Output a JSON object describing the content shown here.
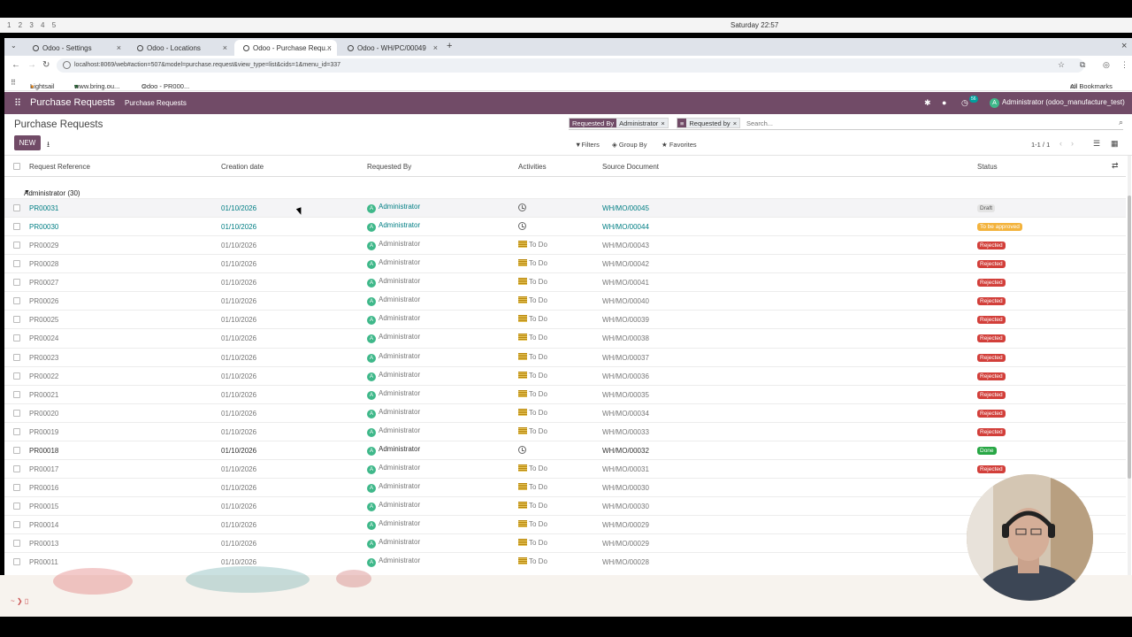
{
  "os": {
    "workspaces": "1 2 3 4 5",
    "clock": "Saturday 22:57"
  },
  "browser": {
    "tabs": [
      {
        "label": "Odoo - Settings",
        "active": false
      },
      {
        "label": "Odoo - Locations",
        "active": false
      },
      {
        "label": "Odoo - Purchase Requ...",
        "active": true
      },
      {
        "label": "Odoo - WH/PC/00049",
        "active": false
      }
    ],
    "url": "localhost:8069/web#action=507&model=purchase.request&view_type=list&cids=1&menu_id=337",
    "bookmarks": [
      "Lightsail",
      "www.bring.ou...",
      "Odoo - PR000..."
    ],
    "all_bookmarks": "All Bookmarks"
  },
  "odoo": {
    "app_name": "Purchase Requests",
    "menu": [
      "Purchase Requests"
    ],
    "activity_count": "56",
    "user": "Administrator (odoo_manufacture_test)",
    "user_initial": "A",
    "page_title": "Purchase Requests",
    "new_label": "NEW",
    "facets": [
      {
        "key": "Requested By",
        "value": "Administrator"
      },
      {
        "key": "",
        "value": "Requested by"
      }
    ],
    "search_placeholder": "Search...",
    "filters_label": "Filters",
    "groupby_label": "Group By",
    "favorites_label": "Favorites",
    "pager": "1-1 / 1",
    "columns": [
      "Request Reference",
      "Creation date",
      "Requested By",
      "Activities",
      "Source Document",
      "Status"
    ],
    "group_label": "Administrator (30)",
    "rows": [
      {
        "ref": "PR00031",
        "date": "01/10/2026",
        "by": "Administrator",
        "activity": "",
        "src": "WH/MO/00045",
        "status": "Draft",
        "style": "link"
      },
      {
        "ref": "PR00030",
        "date": "01/10/2026",
        "by": "Administrator",
        "activity": "",
        "src": "WH/MO/00044",
        "status": "To be approved",
        "style": "link"
      },
      {
        "ref": "PR00029",
        "date": "01/10/2026",
        "by": "Administrator",
        "activity": "To Do",
        "src": "WH/MO/00043",
        "status": "Rejected",
        "style": "muted"
      },
      {
        "ref": "PR00028",
        "date": "01/10/2026",
        "by": "Administrator",
        "activity": "To Do",
        "src": "WH/MO/00042",
        "status": "Rejected",
        "style": "muted"
      },
      {
        "ref": "PR00027",
        "date": "01/10/2026",
        "by": "Administrator",
        "activity": "To Do",
        "src": "WH/MO/00041",
        "status": "Rejected",
        "style": "muted"
      },
      {
        "ref": "PR00026",
        "date": "01/10/2026",
        "by": "Administrator",
        "activity": "To Do",
        "src": "WH/MO/00040",
        "status": "Rejected",
        "style": "muted"
      },
      {
        "ref": "PR00025",
        "date": "01/10/2026",
        "by": "Administrator",
        "activity": "To Do",
        "src": "WH/MO/00039",
        "status": "Rejected",
        "style": "muted"
      },
      {
        "ref": "PR00024",
        "date": "01/10/2026",
        "by": "Administrator",
        "activity": "To Do",
        "src": "WH/MO/00038",
        "status": "Rejected",
        "style": "muted"
      },
      {
        "ref": "PR00023",
        "date": "01/10/2026",
        "by": "Administrator",
        "activity": "To Do",
        "src": "WH/MO/00037",
        "status": "Rejected",
        "style": "muted"
      },
      {
        "ref": "PR00022",
        "date": "01/10/2026",
        "by": "Administrator",
        "activity": "To Do",
        "src": "WH/MO/00036",
        "status": "Rejected",
        "style": "muted"
      },
      {
        "ref": "PR00021",
        "date": "01/10/2026",
        "by": "Administrator",
        "activity": "To Do",
        "src": "WH/MO/00035",
        "status": "Rejected",
        "style": "muted"
      },
      {
        "ref": "PR00020",
        "date": "01/10/2026",
        "by": "Administrator",
        "activity": "To Do",
        "src": "WH/MO/00034",
        "status": "Rejected",
        "style": "muted"
      },
      {
        "ref": "PR00019",
        "date": "01/10/2026",
        "by": "Administrator",
        "activity": "To Do",
        "src": "WH/MO/00033",
        "status": "Rejected",
        "style": "muted"
      },
      {
        "ref": "PR00018",
        "date": "01/10/2026",
        "by": "Administrator",
        "activity": "",
        "src": "WH/MO/00032",
        "status": "Done",
        "style": "dark"
      },
      {
        "ref": "PR00017",
        "date": "01/10/2026",
        "by": "Administrator",
        "activity": "To Do",
        "src": "WH/MO/00031",
        "status": "Rejected",
        "style": "muted"
      },
      {
        "ref": "PR00016",
        "date": "01/10/2026",
        "by": "Administrator",
        "activity": "To Do",
        "src": "WH/MO/00030",
        "status": "",
        "style": "muted"
      },
      {
        "ref": "PR00015",
        "date": "01/10/2026",
        "by": "Administrator",
        "activity": "To Do",
        "src": "WH/MO/00030",
        "status": "",
        "style": "muted"
      },
      {
        "ref": "PR00014",
        "date": "01/10/2026",
        "by": "Administrator",
        "activity": "To Do",
        "src": "WH/MO/00029",
        "status": "",
        "style": "muted"
      },
      {
        "ref": "PR00013",
        "date": "01/10/2026",
        "by": "Administrator",
        "activity": "To Do",
        "src": "WH/MO/00029",
        "status": "",
        "style": "muted"
      },
      {
        "ref": "PR00011",
        "date": "01/10/2026",
        "by": "Administrator",
        "activity": "To Do",
        "src": "WH/MO/00028",
        "status": "",
        "style": "muted"
      }
    ],
    "status_colors": {
      "Draft": "#e4e4e4",
      "To be approved": "#f3b33d",
      "Rejected": "#d23f3a",
      "Done": "#28a745"
    },
    "brand_color": "#714b67",
    "link_color": "#017e84"
  }
}
